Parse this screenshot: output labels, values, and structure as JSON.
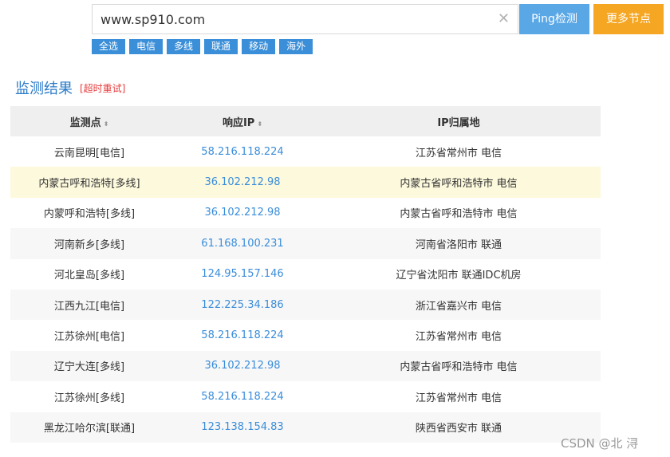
{
  "search": {
    "value": "www.sp910.com",
    "clear_icon": "✕"
  },
  "buttons": {
    "ping": "Ping检测",
    "more_nodes": "更多节点"
  },
  "filters": [
    "全选",
    "电信",
    "多线",
    "联通",
    "移动",
    "海外"
  ],
  "results": {
    "title": "监测结果",
    "retry": "[超时重试]"
  },
  "table": {
    "headers": {
      "node": "监测点",
      "ip": "响应IP",
      "location": "IP归属地"
    },
    "sort_icon": "⬍",
    "rows": [
      {
        "node": "云南昆明[电信]",
        "ip": "58.216.118.224",
        "location": "江苏省常州市 电信"
      },
      {
        "node": "内蒙古呼和浩特[多线]",
        "ip": "36.102.212.98",
        "location": "内蒙古省呼和浩特市 电信"
      },
      {
        "node": "内蒙呼和浩特[多线]",
        "ip": "36.102.212.98",
        "location": "内蒙古省呼和浩特市 电信"
      },
      {
        "node": "河南新乡[多线]",
        "ip": "61.168.100.231",
        "location": "河南省洛阳市 联通"
      },
      {
        "node": "河北皇岛[多线]",
        "ip": "124.95.157.146",
        "location": "辽宁省沈阳市 联通IDC机房"
      },
      {
        "node": "江西九江[电信]",
        "ip": "122.225.34.186",
        "location": "浙江省嘉兴市 电信"
      },
      {
        "node": "江苏徐州[电信]",
        "ip": "58.216.118.224",
        "location": "江苏省常州市 电信"
      },
      {
        "node": "辽宁大连[多线]",
        "ip": "36.102.212.98",
        "location": "内蒙古省呼和浩特市 电信"
      },
      {
        "node": "江苏徐州[多线]",
        "ip": "58.216.118.224",
        "location": "江苏省常州市 电信"
      },
      {
        "node": "黑龙江哈尔滨[联通]",
        "ip": "123.138.154.83",
        "location": "陕西省西安市 联通"
      }
    ]
  },
  "watermark": "CSDN @北  浔",
  "colors": {
    "ping_button": "#5aa7e6",
    "more_button": "#f5a623",
    "filter_tag": "#3b8fd8",
    "ip_link": "#3a8ddb",
    "highlight_row": "#fdf9dc",
    "retry": "#e53a3a"
  }
}
